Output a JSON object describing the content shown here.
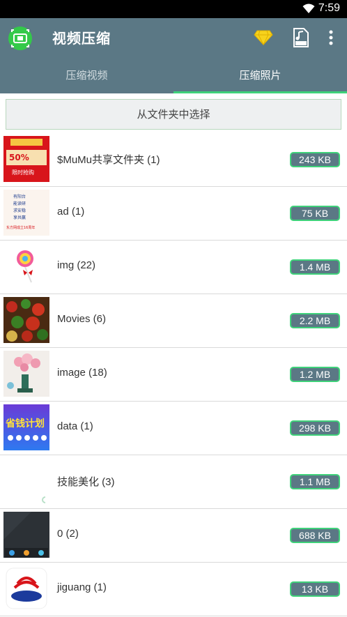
{
  "status": {
    "time": "7:59"
  },
  "app": {
    "title": "视频压缩"
  },
  "tabs": [
    {
      "label": "压缩视频"
    },
    {
      "label": "压缩照片"
    }
  ],
  "choose_button": "从文件夹中选择",
  "folders": [
    {
      "name": "$MuMu共享文件夹 (1)",
      "size": "243 KB"
    },
    {
      "name": "ad (1)",
      "size": "75 KB"
    },
    {
      "name": "img (22)",
      "size": "1.4 MB"
    },
    {
      "name": "Movies (6)",
      "size": "2.2 MB"
    },
    {
      "name": "image (18)",
      "size": "1.2 MB"
    },
    {
      "name": "data (1)",
      "size": "298 KB"
    },
    {
      "name": "技能美化 (3)",
      "size": "1.1 MB"
    },
    {
      "name": "0 (2)",
      "size": "688 KB"
    },
    {
      "name": "jiguang (1)",
      "size": "13 KB"
    }
  ],
  "thumbs": {
    "mumu": {
      "line1": "50%",
      "line2": "限时抢购"
    },
    "ad": {
      "lines": [
        "有阳台",
        "能读研",
        "求安稳",
        "享共赢"
      ],
      "footer": "东方网成立16周年"
    },
    "data": {
      "text": "省钱计划"
    }
  },
  "colors": {
    "appbar": "#5b7885",
    "accent": "#3fd27a"
  }
}
